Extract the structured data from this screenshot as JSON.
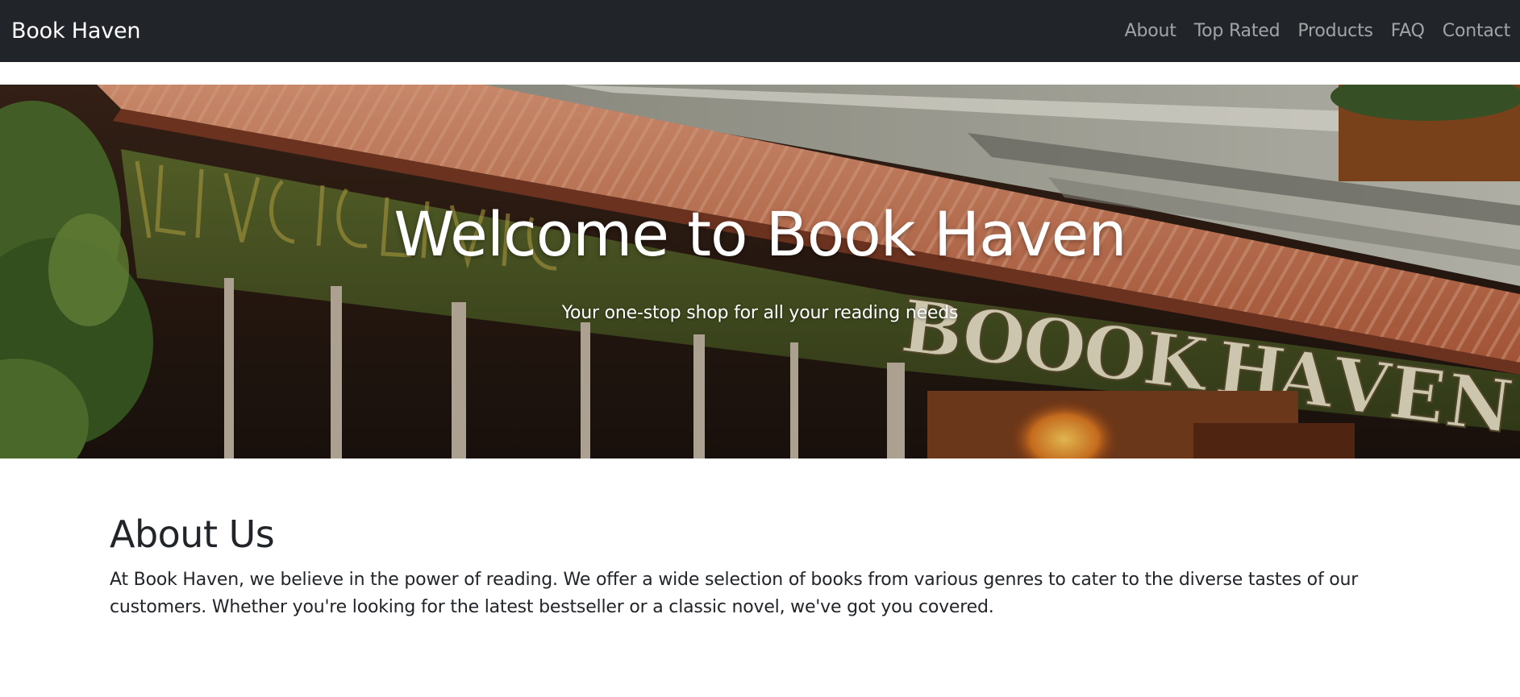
{
  "navbar": {
    "brand": "Book Haven",
    "links": [
      "About",
      "Top Rated",
      "Products",
      "FAQ",
      "Contact"
    ]
  },
  "hero": {
    "title": "Welcome to Book Haven",
    "subtitle": "Your one-stop shop for all your reading needs",
    "image_alt": "BOOOK HAVEN"
  },
  "about": {
    "heading": "About Us",
    "text": "At Book Haven, we believe in the power of reading. We offer a wide selection of books from various genres to cater to the diverse tastes of our customers. Whether you're looking for the latest bestseller or a classic novel, we've got you covered."
  },
  "colors": {
    "navbar_bg": "#212529",
    "nav_link": "#a6a8aa",
    "brand": "#ffffff",
    "awning": "#d9825f",
    "sign_green": "#4f5a26",
    "sign_letters": "#e9e2c6"
  }
}
